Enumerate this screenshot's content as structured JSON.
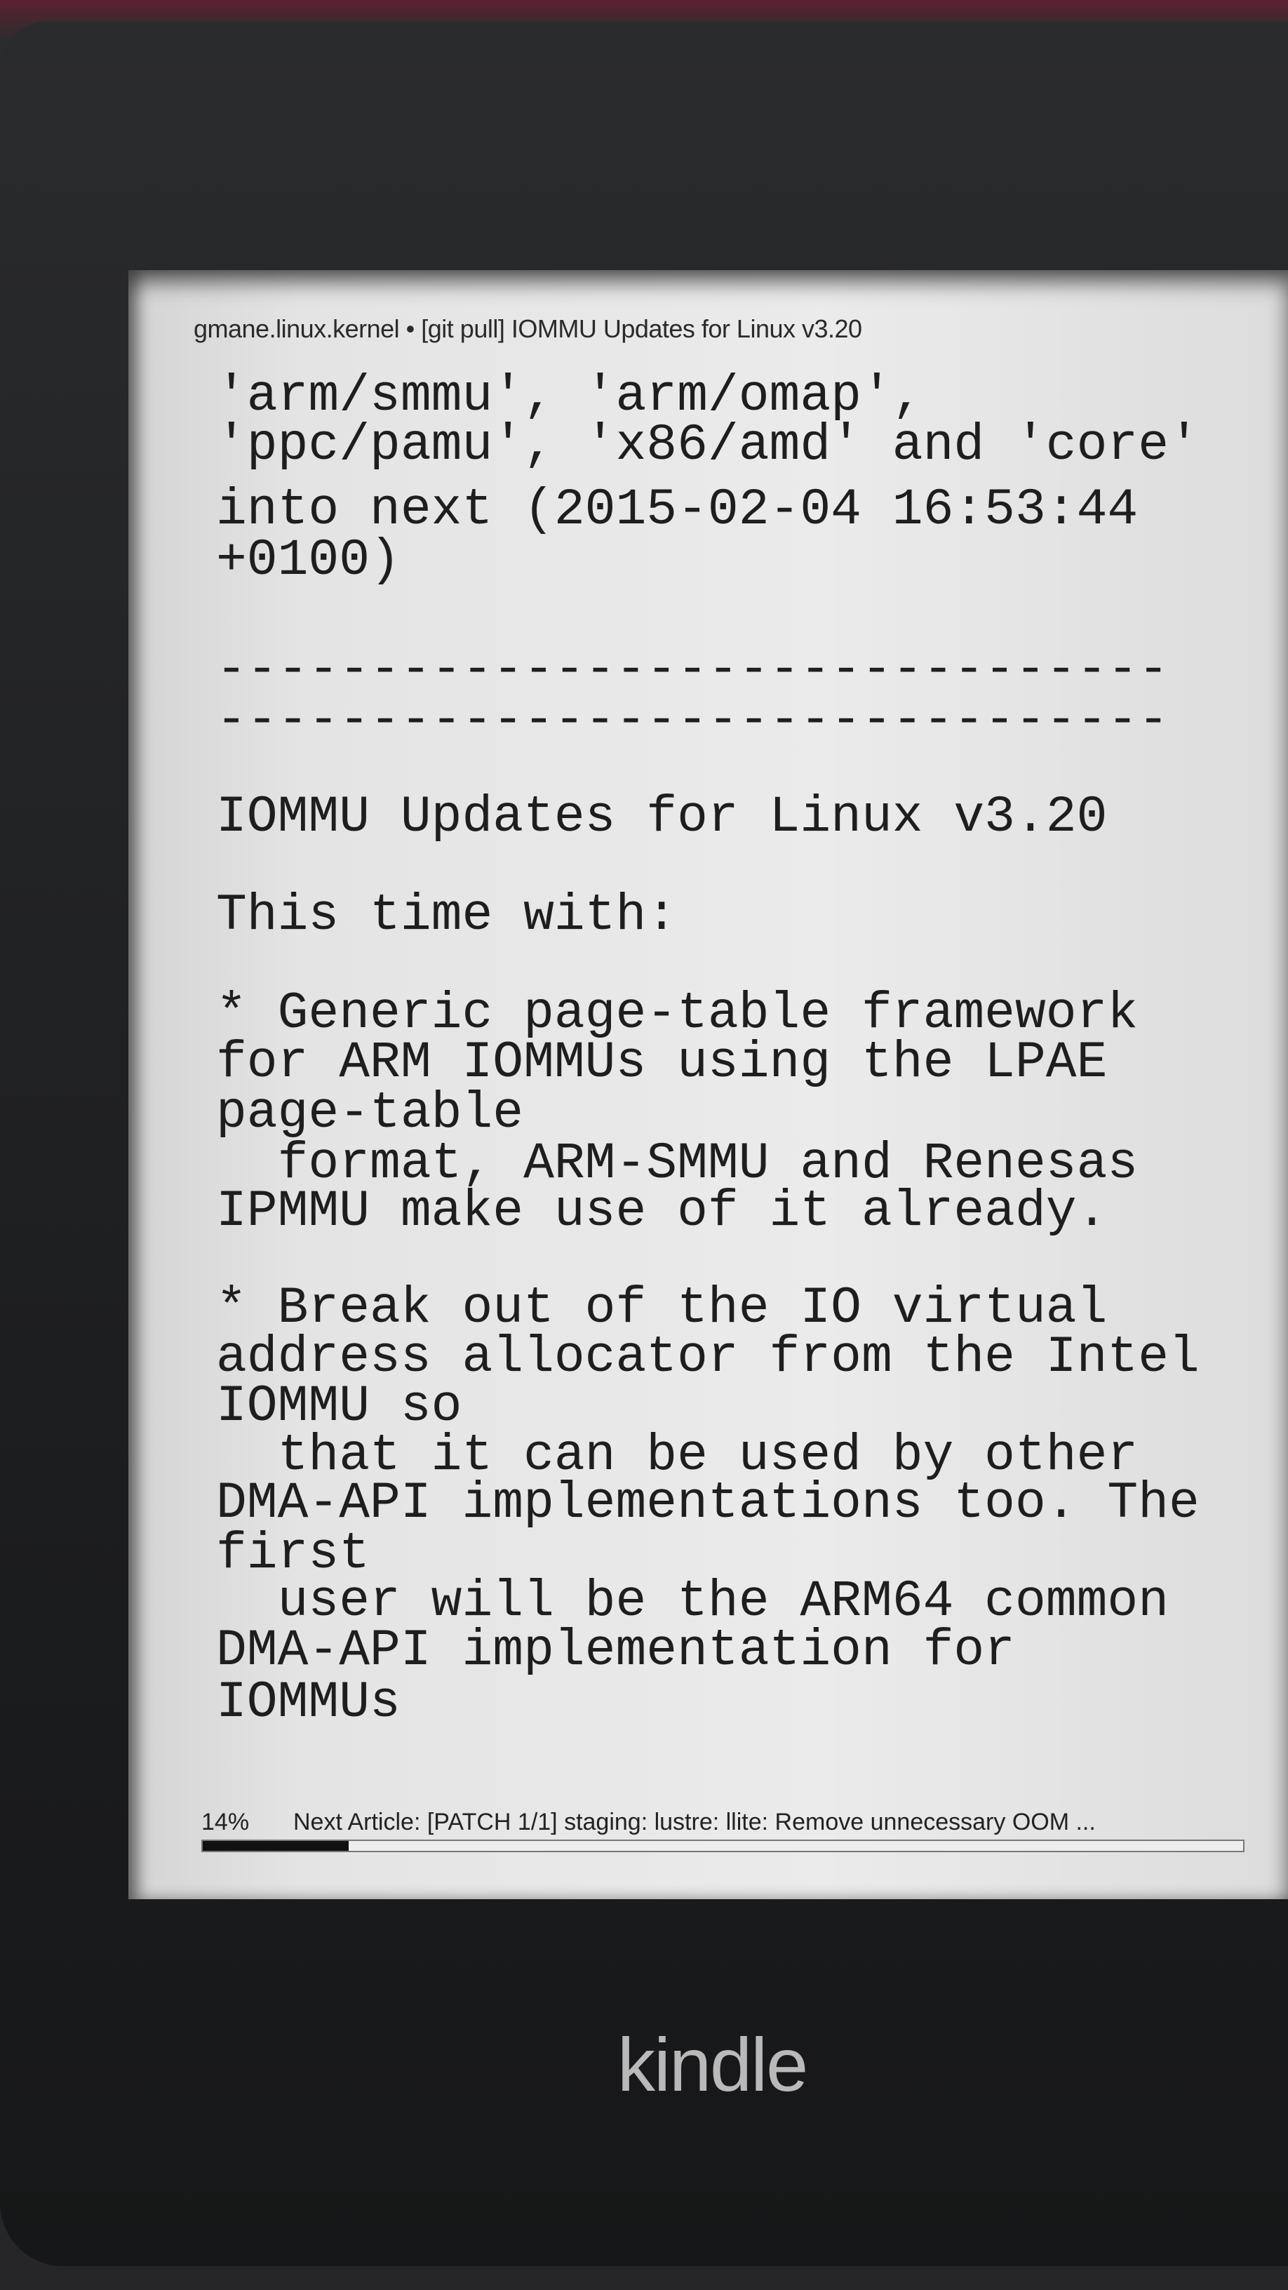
{
  "header": {
    "title": "gmane.linux.kernel • [git pull] IOMMU Updates for Linux v3.20"
  },
  "article": {
    "lines": [
      "'arm/smmu', 'arm/omap',",
      "'ppc/pamu', 'x86/amd' and 'core'",
      "into next (2015-02-04 16:53:44",
      "+0100)",
      "-------------------------------",
      "-------------------------------",
      "IOMMU Updates for Linux v3.20",
      "This time with:",
      "* Generic page-table framework",
      "for ARM IOMMUs using the LPAE",
      "page-table",
      "  format, ARM-SMMU and Renesas",
      "IPMMU make use of it already.",
      "* Break out of the IO virtual",
      "address allocator from the Intel",
      "IOMMU so",
      "  that it can be used by other",
      "DMA-API implementations too. The",
      "first",
      "  user will be the ARM64 common",
      "DMA-API implementation for",
      "IOMMUs"
    ]
  },
  "footer": {
    "progress_label": "14%",
    "progress_value": 14,
    "next_article": "Next Article: [PATCH 1/1] staging: lustre: llite: Remove unnecessary OOM ..."
  },
  "device": {
    "logo": "kindle"
  }
}
